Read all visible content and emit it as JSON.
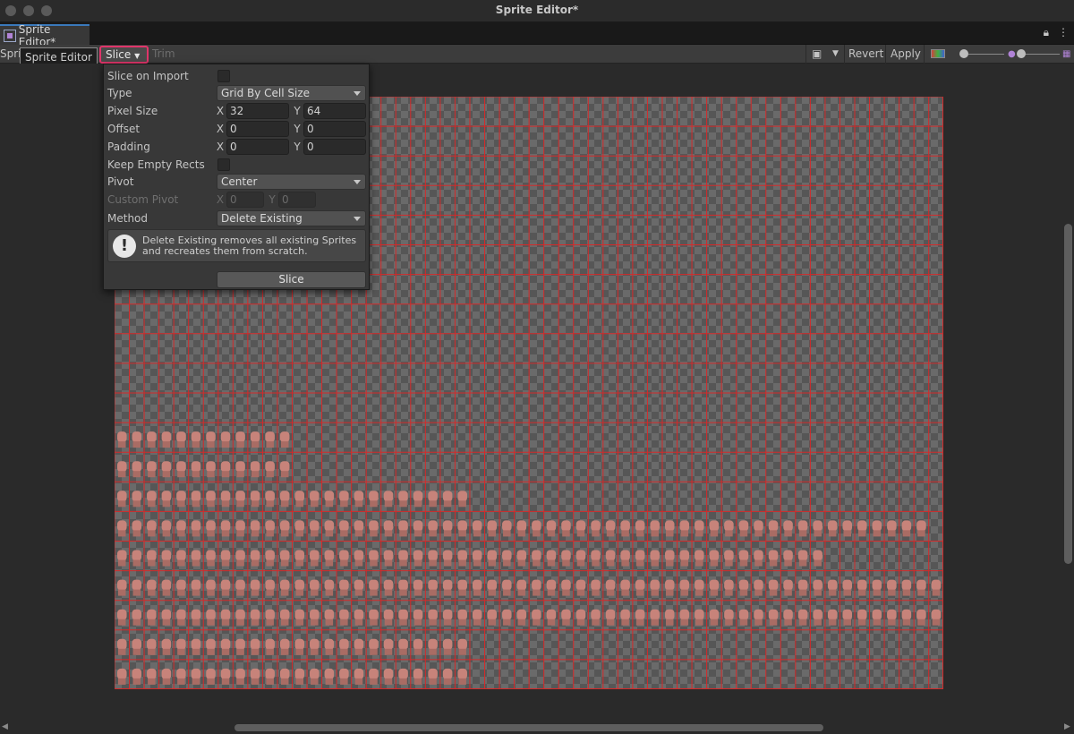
{
  "window": {
    "title": "Sprite Editor*"
  },
  "tab": {
    "label": "Sprite Editor*",
    "right_icons": [
      "lock-icon",
      "more-icon"
    ]
  },
  "toolbar": {
    "mode_label": "Spri",
    "tooltip": "Sprite Editor",
    "slice_label": "Slice",
    "trim_label": "Trim",
    "revert_label": "Revert",
    "apply_label": "Apply"
  },
  "slice_panel": {
    "slice_on_import": {
      "label": "Slice on Import",
      "checked": false
    },
    "type": {
      "label": "Type",
      "value": "Grid By Cell Size"
    },
    "pixel_size": {
      "label": "Pixel Size",
      "x_label": "X",
      "x": "32",
      "y_label": "Y",
      "y": "64"
    },
    "offset": {
      "label": "Offset",
      "x_label": "X",
      "x": "0",
      "y_label": "Y",
      "y": "0"
    },
    "padding": {
      "label": "Padding",
      "x_label": "X",
      "x": "0",
      "y_label": "Y",
      "y": "0"
    },
    "keep_empty_rects": {
      "label": "Keep Empty Rects",
      "checked": false
    },
    "pivot": {
      "label": "Pivot",
      "value": "Center"
    },
    "custom_pivot": {
      "label": "Custom Pivot",
      "x_label": "X",
      "x": "0",
      "y_label": "Y",
      "y": "0"
    },
    "method": {
      "label": "Method",
      "value": "Delete Existing"
    },
    "help_text": "Delete Existing removes all existing Sprites and recreates them from scratch.",
    "slice_button": "Slice"
  },
  "colors": {
    "highlight": "#e0356a",
    "grid_line": "#d42a2a",
    "sprite": "#c7837a",
    "tab_accent": "#3a79bb"
  }
}
